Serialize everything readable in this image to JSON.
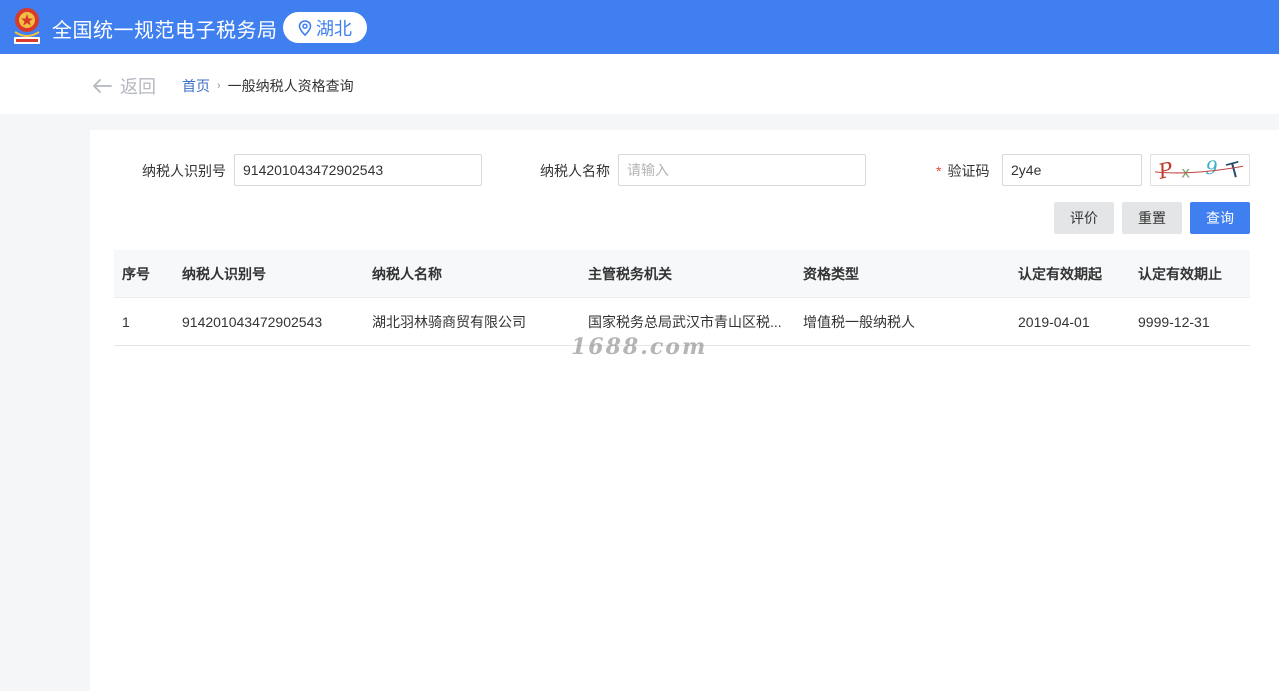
{
  "header": {
    "site_title": "全国统一规范电子税务局",
    "region": "湖北",
    "brand_color": "#3f7ff0"
  },
  "nav": {
    "back_label": "返回",
    "breadcrumb": {
      "home": "首页",
      "current": "一般纳税人资格查询"
    }
  },
  "form": {
    "taxpayer_id_label": "纳税人识别号",
    "taxpayer_id_value": "914201043472902543",
    "taxpayer_name_label": "纳税人名称",
    "taxpayer_name_placeholder": "请输入",
    "taxpayer_name_value": "",
    "captcha_required_mark": "*",
    "captcha_label": "验证码",
    "captcha_value": "2y4e",
    "buttons": {
      "evaluate": "评价",
      "reset": "重置",
      "query": "查询"
    }
  },
  "table": {
    "columns": [
      "序号",
      "纳税人识别号",
      "纳税人名称",
      "主管税务机关",
      "资格类型",
      "认定有效期起",
      "认定有效期止"
    ],
    "rows": [
      [
        "1",
        "914201043472902543",
        "湖北羽林骑商贸有限公司",
        "国家税务总局武汉市青山区税...",
        "增值税一般纳税人",
        "2019-04-01",
        "9999-12-31"
      ]
    ]
  },
  "watermark": "1688.com"
}
